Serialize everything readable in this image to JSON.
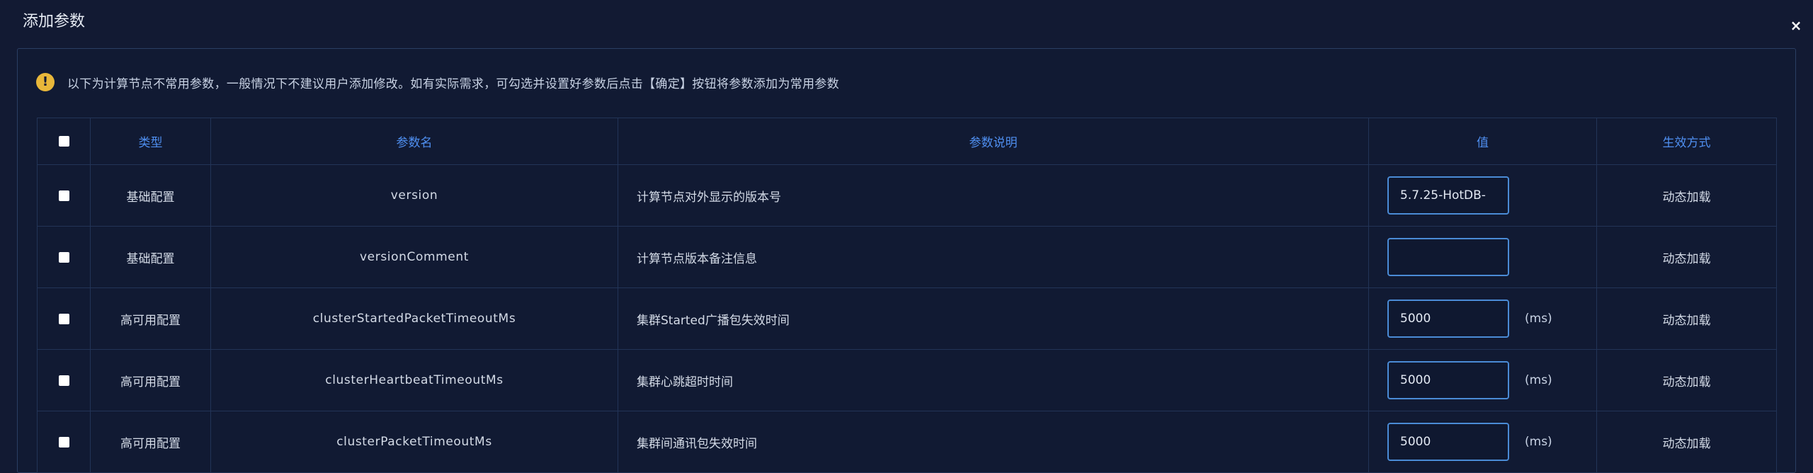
{
  "dialog": {
    "title": "添加参数",
    "close_label": "×"
  },
  "notice": {
    "icon": "!",
    "text": "以下为计算节点不常用参数，一般情况下不建议用户添加修改。如有实际需求，可勾选并设置好参数后点击【确定】按钮将参数添加为常用参数"
  },
  "table": {
    "columns": [
      "类型",
      "参数名",
      "参数说明",
      "值",
      "生效方式"
    ],
    "rows": [
      {
        "type": "基础配置",
        "name": "version",
        "desc": "计算节点对外显示的版本号",
        "value": "5.7.25-HotDB-",
        "unit": "",
        "mode": "动态加载"
      },
      {
        "type": "基础配置",
        "name": "versionComment",
        "desc": "计算节点版本备注信息",
        "value": "",
        "unit": "",
        "mode": "动态加载"
      },
      {
        "type": "高可用配置",
        "name": "clusterStartedPacketTimeoutMs",
        "desc": "集群Started广播包失效时间",
        "value": "5000",
        "unit": "(ms)",
        "mode": "动态加载"
      },
      {
        "type": "高可用配置",
        "name": "clusterHeartbeatTimeoutMs",
        "desc": "集群心跳超时时间",
        "value": "5000",
        "unit": "(ms)",
        "mode": "动态加载"
      },
      {
        "type": "高可用配置",
        "name": "clusterPacketTimeoutMs",
        "desc": "集群间通讯包失效时间",
        "value": "5000",
        "unit": "(ms)",
        "mode": "动态加载"
      }
    ]
  },
  "colors": {
    "background": "#121a33",
    "header_text": "#4f8ff0",
    "input_border": "#4a8bd6",
    "warning": "#e8b73a"
  }
}
